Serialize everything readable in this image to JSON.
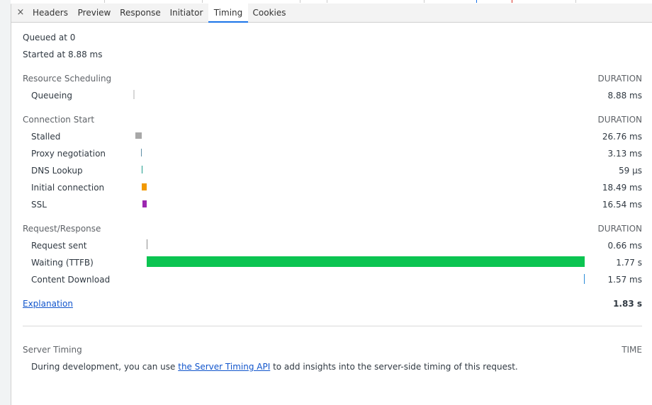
{
  "tabs": {
    "close_icon": "×",
    "items": [
      {
        "label": "Headers"
      },
      {
        "label": "Preview"
      },
      {
        "label": "Response"
      },
      {
        "label": "Initiator"
      },
      {
        "label": "Timing",
        "active": true
      },
      {
        "label": "Cookies"
      }
    ]
  },
  "summary": {
    "queued": "Queued at 0",
    "started": "Started at 8.88 ms"
  },
  "sections": {
    "resource_scheduling": {
      "title": "Resource Scheduling",
      "header": "DURATION",
      "rows": [
        {
          "label": "Queueing",
          "value": "8.88 ms"
        }
      ]
    },
    "connection_start": {
      "title": "Connection Start",
      "header": "DURATION",
      "rows": [
        {
          "label": "Stalled",
          "value": "26.76 ms"
        },
        {
          "label": "Proxy negotiation",
          "value": "3.13 ms"
        },
        {
          "label": "DNS Lookup",
          "value": "59 μs"
        },
        {
          "label": "Initial connection",
          "value": "18.49 ms"
        },
        {
          "label": "SSL",
          "value": "16.54 ms"
        }
      ]
    },
    "request_response": {
      "title": "Request/Response",
      "header": "DURATION",
      "rows": [
        {
          "label": "Request sent",
          "value": "0.66 ms"
        },
        {
          "label": "Waiting (TTFB)",
          "value": "1.77 s"
        },
        {
          "label": "Content Download",
          "value": "1.57 ms"
        }
      ]
    }
  },
  "footer": {
    "explanation_link": "Explanation",
    "total": "1.83 s"
  },
  "server_timing": {
    "title": "Server Timing",
    "header": "TIME",
    "text_before": "During development, you can use ",
    "link": "the Server Timing API",
    "text_after": " to add insights into the server-side timing of this request."
  },
  "colors": {
    "queueing": "#c8c8c8",
    "stalled": "#a8a8a8",
    "proxy": "#5f8fa6",
    "dns": "#1e9c8c",
    "initial_connection": "#f29900",
    "ssl": "#9c27b0",
    "request_sent": "#8e8e8e",
    "waiting": "#0bc451",
    "content_download": "#2a8bd8"
  }
}
